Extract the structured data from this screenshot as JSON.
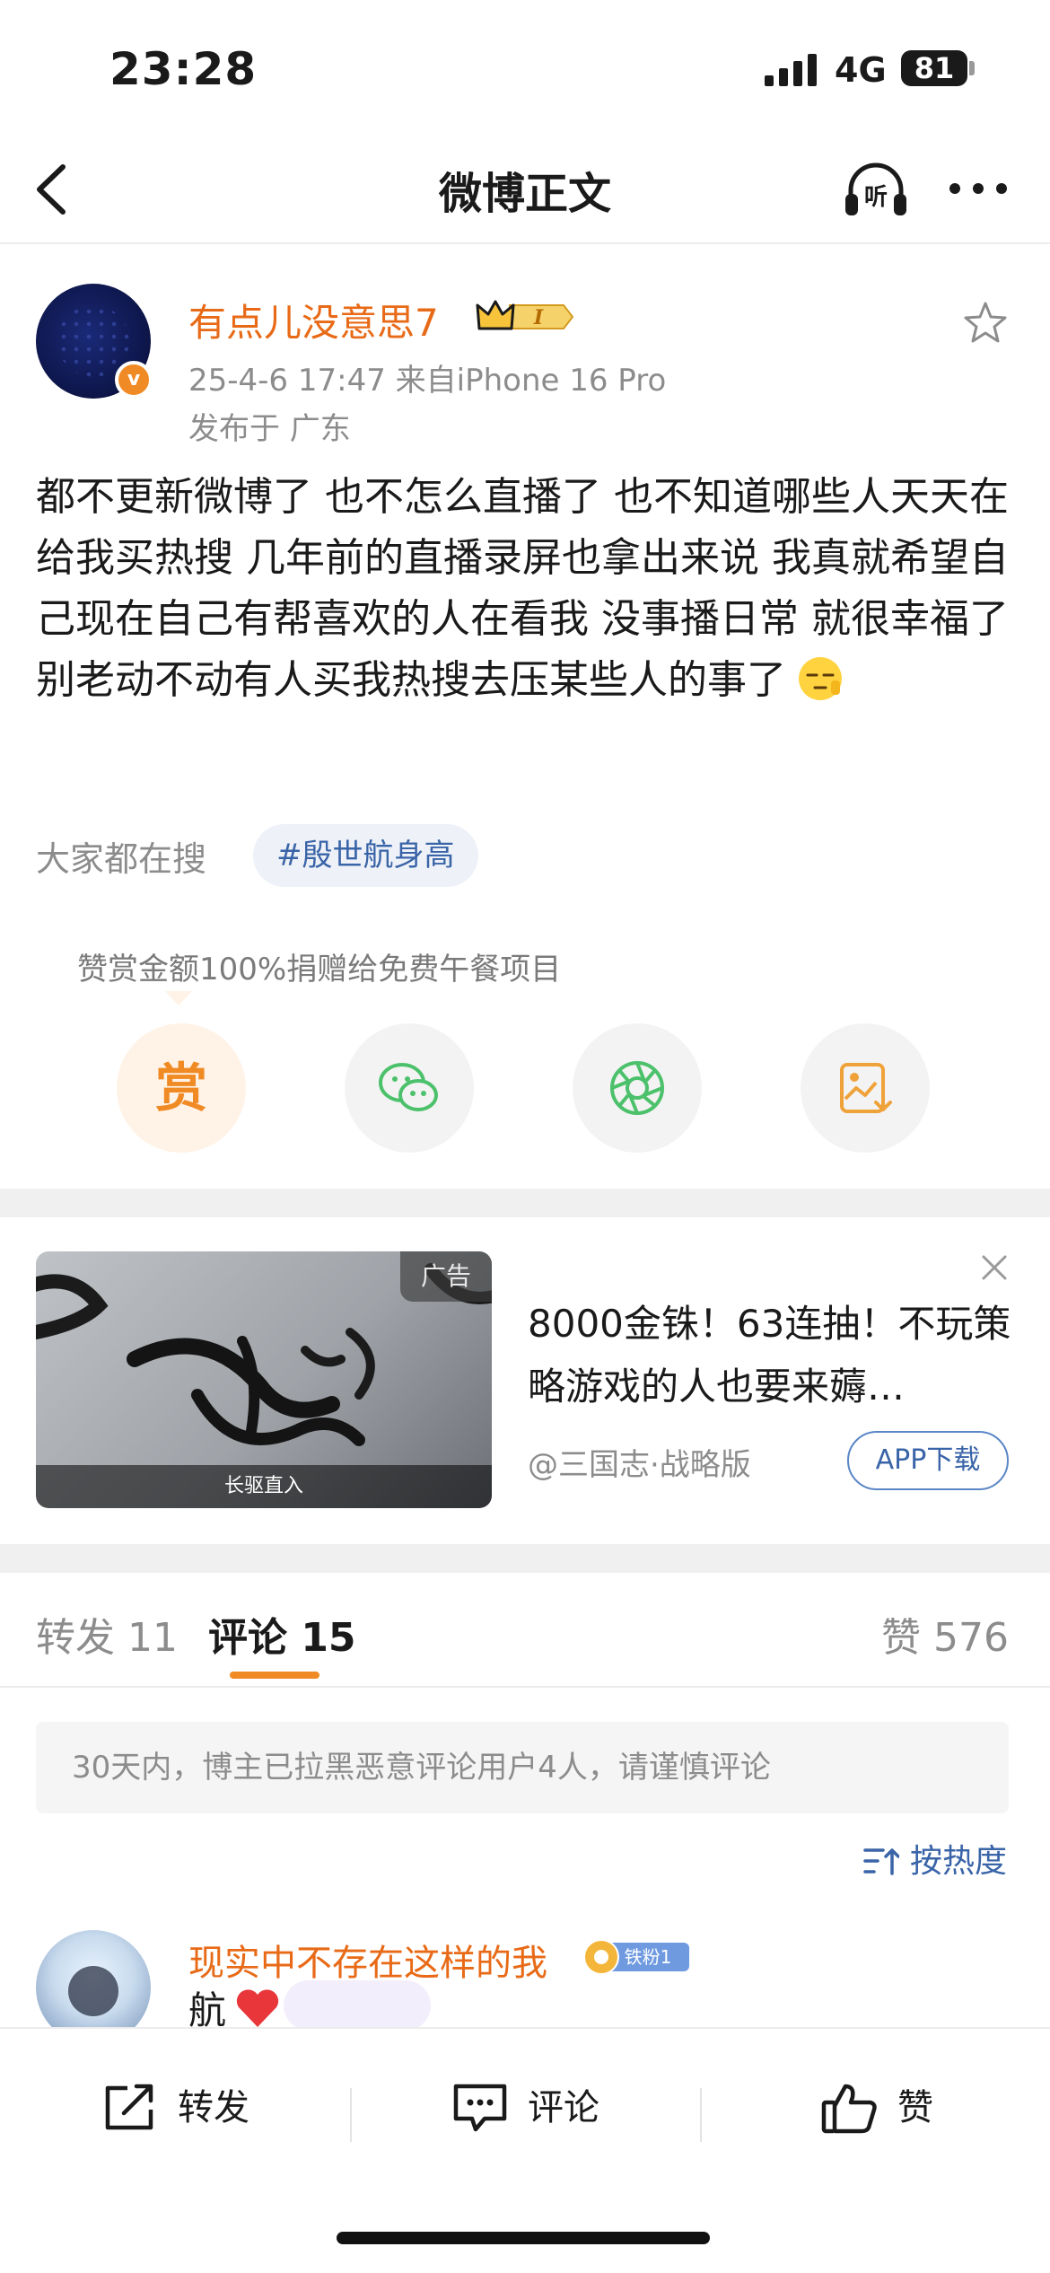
{
  "status_bar": {
    "time": "23:28",
    "network": "4G",
    "battery": "81"
  },
  "nav": {
    "title": "微博正文"
  },
  "post": {
    "author": "有点儿没意思7",
    "badge_text": "I",
    "meta": "25-4-6 17:47  来自iPhone 16 Pro",
    "location": "发布于 广东",
    "body": "都不更新微博了 也不怎么直播了 也不知道哪些人天天在给我买热搜 几年前的直播录屏也拿出来说 我真就希望自己现在自己有帮喜欢的人在看我 没事播日常 就很幸福了 别老动不动有人买我热搜去压某些人的事了",
    "search_label": "大家都在搜",
    "hashtag": "#殷世航身高"
  },
  "reward": {
    "tip": "赞赏金额100%捐赠给免费午餐项目",
    "reward_glyph": "赏"
  },
  "ad": {
    "tag": "广告",
    "caption": "长驱直入",
    "title": "8000金铢！63连抽！不玩策略游戏的人也要来薅…",
    "source": "@三国志·战略版",
    "download": "APP下载"
  },
  "tabs": {
    "repost": "转发 11",
    "comments": "评论 15",
    "likes": "赞 576"
  },
  "notice": "30天内，博主已拉黑恶意评论用户4人，请谨慎评论",
  "sort": {
    "label": "按热度"
  },
  "comment": {
    "author": "现实中不存在这样的我",
    "fan_badge": "铁粉1",
    "text": "航"
  },
  "bottom_bar": {
    "repost": "转发",
    "comment": "评论",
    "like": "赞"
  },
  "colors": {
    "accent_orange": "#f08a24",
    "name_orange": "#e86a17",
    "link_blue": "#3a64a8",
    "wechat_green": "#4cc16b"
  },
  "icons": [
    "back-icon",
    "listen-icon",
    "more-icon",
    "star-icon",
    "wechat-icon",
    "moments-icon",
    "save-image-icon",
    "close-icon",
    "sort-icon",
    "share-icon",
    "comment-icon",
    "like-icon"
  ]
}
